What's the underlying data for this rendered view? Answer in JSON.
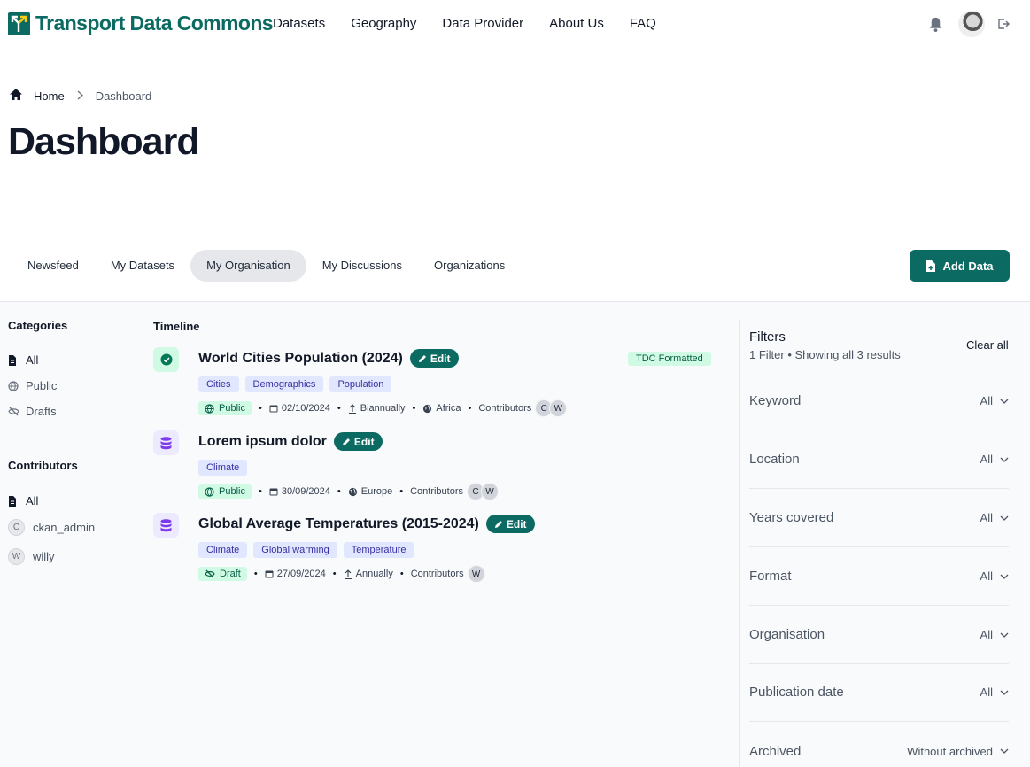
{
  "header": {
    "brand": "Transport Data Commons",
    "nav": [
      "Datasets",
      "Geography",
      "Data Provider",
      "About Us",
      "FAQ"
    ]
  },
  "breadcrumb": {
    "home": "Home",
    "current": "Dashboard"
  },
  "page_title": "Dashboard",
  "tabs": [
    "Newsfeed",
    "My Datasets",
    "My Organisation",
    "My Discussions",
    "Organizations"
  ],
  "active_tab": "My Organisation",
  "add_button": "Add Data",
  "sidebar": {
    "categories_title": "Categories",
    "categories": [
      "All",
      "Public",
      "Drafts"
    ],
    "contributors_title": "Contributors",
    "contributors": [
      {
        "initial": "",
        "name": "All"
      },
      {
        "initial": "C",
        "name": "ckan_admin"
      },
      {
        "initial": "W",
        "name": "willy"
      }
    ]
  },
  "timeline": {
    "title": "Timeline",
    "edit_label": "Edit",
    "contributors_label": "Contributors",
    "entries": [
      {
        "name": "World Cities Population (2024)",
        "badge": "TDC Formatted",
        "tags": [
          "Cities",
          "Demographics",
          "Population"
        ],
        "visibility": "Public",
        "date": "02/10/2024",
        "frequency": "Biannually",
        "region": "Africa",
        "contributors": [
          "C",
          "W"
        ]
      },
      {
        "name": "Lorem ipsum dolor",
        "tags": [
          "Climate"
        ],
        "visibility": "Public",
        "date": "30/09/2024",
        "region": "Europe",
        "contributors": [
          "C",
          "W"
        ]
      },
      {
        "name": "Global Average Temperatures (2015-2024)",
        "tags": [
          "Climate",
          "Global warming",
          "Temperature"
        ],
        "visibility": "Draft",
        "date": "27/09/2024",
        "frequency": "Annually",
        "contributors": [
          "W"
        ]
      }
    ]
  },
  "filters": {
    "title": "Filters",
    "subtitle": "1 Filter • Showing all 3 results",
    "clear": "Clear all",
    "rows": [
      {
        "label": "Keyword",
        "value": "All"
      },
      {
        "label": "Location",
        "value": "All"
      },
      {
        "label": "Years covered",
        "value": "All"
      },
      {
        "label": "Format",
        "value": "All"
      },
      {
        "label": "Organisation",
        "value": "All"
      },
      {
        "label": "Publication date",
        "value": "All"
      },
      {
        "label": "Archived",
        "value": "Without archived"
      }
    ]
  },
  "colors": {
    "brand": "#0b6b62",
    "public_bg": "#d1fae5",
    "tag_bg": "#e0e7ff"
  }
}
